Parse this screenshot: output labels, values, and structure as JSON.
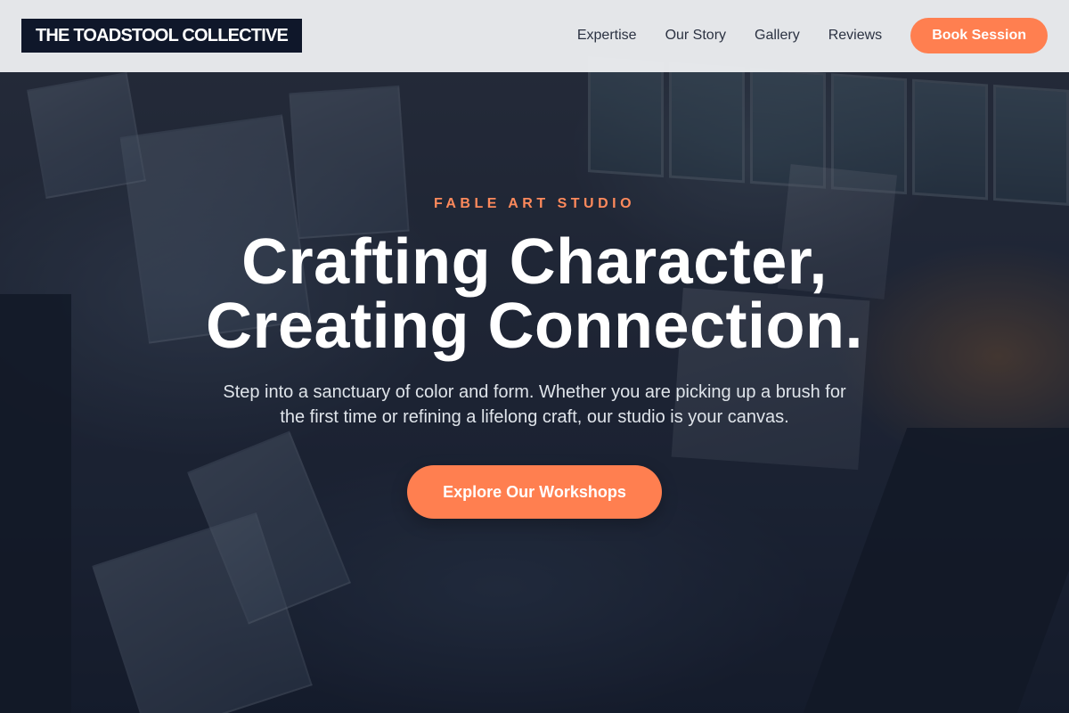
{
  "header": {
    "logo_text": "THE TOADSTOOL COLLECTIVE",
    "nav": {
      "expertise": "Expertise",
      "our_story": "Our Story",
      "gallery": "Gallery",
      "reviews": "Reviews"
    },
    "book_label": "Book Session"
  },
  "hero": {
    "eyebrow": "FABLE ART STUDIO",
    "headline_line1": "Crafting Character,",
    "headline_line2": "Creating Connection.",
    "subtext": "Step into a sanctuary of color and form. Whether you are picking up a brush for the first time or refining a lifelong craft, our studio is your canvas.",
    "cta_label": "Explore Our Workshops"
  },
  "colors": {
    "accent": "#ff7f50",
    "header_bg": "#eceef0",
    "logo_bg": "#0f172a",
    "eyebrow": "#ff8a5c"
  }
}
